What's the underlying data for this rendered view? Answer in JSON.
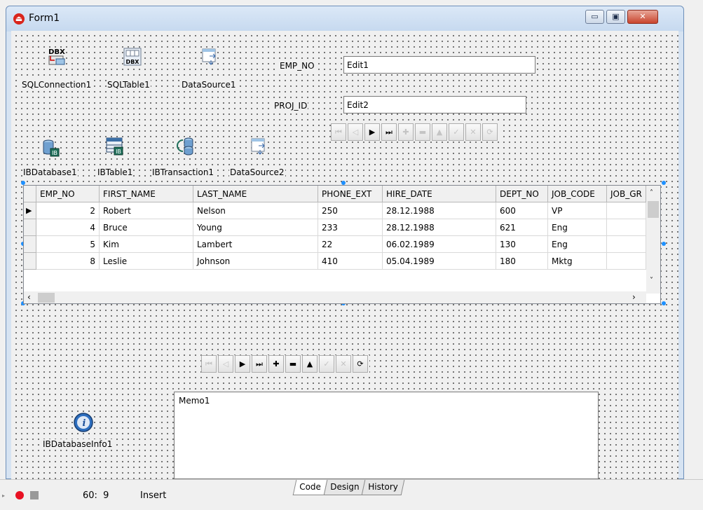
{
  "window": {
    "title": "Form1",
    "buttons": {
      "minimize": "▭",
      "restore": "▣",
      "close": "✕"
    }
  },
  "components": {
    "sqlconnection": {
      "label": "SQLConnection1",
      "icon": "dbx-connection-icon",
      "glyph": "DBX"
    },
    "sqltable": {
      "label": "SQLTable1",
      "icon": "dbx-table-icon",
      "glyph": "DBX"
    },
    "datasource1": {
      "label": "DataSource1",
      "icon": "datasource-icon"
    },
    "ibdatabase": {
      "label": "IBDatabase1",
      "icon": "ib-database-icon"
    },
    "ibtable": {
      "label": "IBTable1",
      "icon": "ib-table-icon"
    },
    "ibtransaction": {
      "label": "IBTransaction1",
      "icon": "ib-transaction-icon"
    },
    "datasource2": {
      "label": "DataSource2",
      "icon": "datasource-icon"
    },
    "ibdatabaseinfo": {
      "label": "IBDatabaseInfo1",
      "icon": "ib-database-info-icon"
    }
  },
  "fields": {
    "emp_no": {
      "label": "EMP_NO",
      "value": "Edit1"
    },
    "proj_id": {
      "label": "PROJ_ID",
      "value": "Edit2"
    }
  },
  "navigator_glyphs": [
    "⏮",
    "◁",
    "▶",
    "⏭",
    "✚",
    "▬",
    "▲",
    "✓",
    "✕",
    "⟳"
  ],
  "grid": {
    "columns": [
      "EMP_NO",
      "FIRST_NAME",
      "LAST_NAME",
      "PHONE_EXT",
      "HIRE_DATE",
      "DEPT_NO",
      "JOB_CODE",
      "JOB_GR"
    ],
    "rows": [
      [
        "2",
        "Robert",
        "Nelson",
        "250",
        "28.12.1988",
        "600",
        "VP",
        ""
      ],
      [
        "4",
        "Bruce",
        "Young",
        "233",
        "28.12.1988",
        "621",
        "Eng",
        ""
      ],
      [
        "5",
        "Kim",
        "Lambert",
        "22",
        "06.02.1989",
        "130",
        "Eng",
        ""
      ],
      [
        "8",
        "Leslie",
        "Johnson",
        "410",
        "05.04.1989",
        "180",
        "Mktg",
        ""
      ]
    ],
    "current_row_indicator": "▶"
  },
  "memo": {
    "text": "Memo1"
  },
  "statusbar": {
    "position": "60:  9",
    "mode": "Insert",
    "tabs": [
      "Code",
      "Design",
      "History"
    ],
    "active_tab": "Code"
  },
  "colors": {
    "title_bg": "#c6d9ef",
    "close_button": "#c9452e",
    "grip": "#1e90ff"
  }
}
